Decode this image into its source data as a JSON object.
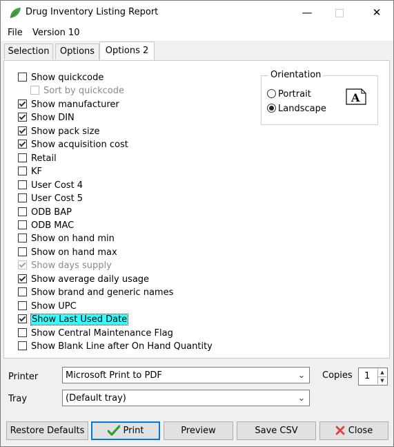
{
  "window": {
    "title": "Drug Inventory Listing Report",
    "minimize_glyph": "—",
    "close_glyph": "✕",
    "icon": "leaf-icon"
  },
  "menu": {
    "file_label": "File",
    "version_label": "Version 10"
  },
  "tabs": {
    "selection": "Selection",
    "options": "Options",
    "options2": "Options 2"
  },
  "options": [
    {
      "label": "Show quickcode",
      "checked": false,
      "disabled": false,
      "indent": false,
      "highlight": false
    },
    {
      "label": "Sort by quickcode",
      "checked": false,
      "disabled": true,
      "indent": true,
      "highlight": false
    },
    {
      "label": "Show manufacturer",
      "checked": true,
      "disabled": false,
      "indent": false,
      "highlight": false
    },
    {
      "label": "Show DIN",
      "checked": true,
      "disabled": false,
      "indent": false,
      "highlight": false
    },
    {
      "label": "Show pack size",
      "checked": true,
      "disabled": false,
      "indent": false,
      "highlight": false
    },
    {
      "label": "Show acquisition cost",
      "checked": true,
      "disabled": false,
      "indent": false,
      "highlight": false
    },
    {
      "label": "Retail",
      "checked": false,
      "disabled": false,
      "indent": false,
      "highlight": false
    },
    {
      "label": "KF",
      "checked": false,
      "disabled": false,
      "indent": false,
      "highlight": false
    },
    {
      "label": "User Cost 4",
      "checked": false,
      "disabled": false,
      "indent": false,
      "highlight": false
    },
    {
      "label": "User Cost 5",
      "checked": false,
      "disabled": false,
      "indent": false,
      "highlight": false
    },
    {
      "label": "ODB BAP",
      "checked": false,
      "disabled": false,
      "indent": false,
      "highlight": false
    },
    {
      "label": "ODB MAC",
      "checked": false,
      "disabled": false,
      "indent": false,
      "highlight": false
    },
    {
      "label": "Show on hand min",
      "checked": false,
      "disabled": false,
      "indent": false,
      "highlight": false
    },
    {
      "label": "Show on hand max",
      "checked": false,
      "disabled": false,
      "indent": false,
      "highlight": false
    },
    {
      "label": "Show days supply",
      "checked": true,
      "disabled": true,
      "indent": false,
      "highlight": false
    },
    {
      "label": "Show average daily usage",
      "checked": true,
      "disabled": false,
      "indent": false,
      "highlight": false
    },
    {
      "label": "Show brand and generic names",
      "checked": false,
      "disabled": false,
      "indent": false,
      "highlight": false
    },
    {
      "label": "Show UPC",
      "checked": false,
      "disabled": false,
      "indent": false,
      "highlight": false
    },
    {
      "label": "Show Last Used Date",
      "checked": true,
      "disabled": false,
      "indent": false,
      "highlight": true
    },
    {
      "label": "Show Central Maintenance Flag",
      "checked": false,
      "disabled": false,
      "indent": false,
      "highlight": false
    },
    {
      "label": "Show Blank Line after On Hand Quantity",
      "checked": false,
      "disabled": false,
      "indent": false,
      "highlight": false
    }
  ],
  "orientation": {
    "legend": "Orientation",
    "portrait_label": "Portrait",
    "landscape_label": "Landscape",
    "selected": "Landscape",
    "icon": "landscape-page-icon",
    "icon_letter": "A"
  },
  "printer": {
    "label": "Printer",
    "value": "Microsoft Print to PDF"
  },
  "tray": {
    "label": "Tray",
    "value": "(Default tray)"
  },
  "copies": {
    "label": "Copies",
    "value": "1"
  },
  "buttons": {
    "restore_defaults": "Restore Defaults",
    "print": "Print",
    "preview": "Preview",
    "save_csv": "Save CSV",
    "close": "Close"
  },
  "colors": {
    "highlight": "#33ffff",
    "print_check": "#2e9e2e",
    "close_x": "#e04040",
    "leaf": "#43a047",
    "default_button_border": "#0078d7"
  }
}
